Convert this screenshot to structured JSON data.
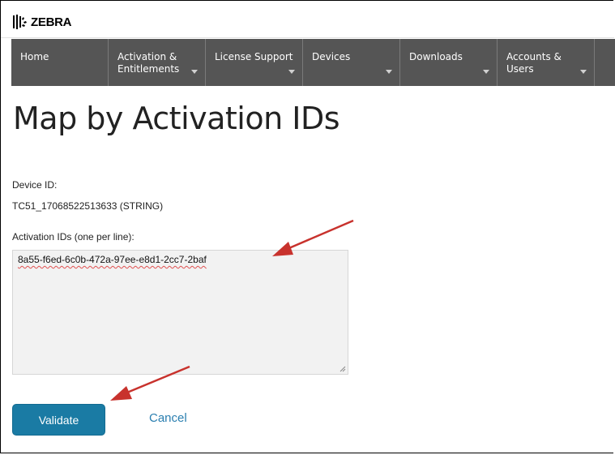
{
  "brand": {
    "name": "ZEBRA"
  },
  "nav": {
    "items": [
      {
        "label_line1": "Home",
        "label_line2": "",
        "has_dropdown": false
      },
      {
        "label_line1": "Activation &",
        "label_line2": "Entitlements",
        "has_dropdown": true
      },
      {
        "label_line1": "License Support",
        "label_line2": "",
        "has_dropdown": true
      },
      {
        "label_line1": "Devices",
        "label_line2": "",
        "has_dropdown": true
      },
      {
        "label_line1": "Downloads",
        "label_line2": "",
        "has_dropdown": true
      },
      {
        "label_line1": "Accounts &",
        "label_line2": "Users",
        "has_dropdown": true
      }
    ]
  },
  "page": {
    "title": "Map by Activation IDs",
    "device_id_label": "Device ID:",
    "device_id_value": "TC51_17068522513633 (STRING)",
    "activation_ids_label": "Activation IDs (one per line):",
    "activation_ids_value": "8a55-f6ed-6c0b-472a-97ee-e8d1-2cc7-2baf"
  },
  "actions": {
    "validate_label": "Validate",
    "cancel_label": "Cancel"
  },
  "colors": {
    "nav_bg": "#555555",
    "primary_button": "#1a7ba4",
    "link": "#2b7fb0",
    "annotation_arrow": "#c8322d"
  }
}
